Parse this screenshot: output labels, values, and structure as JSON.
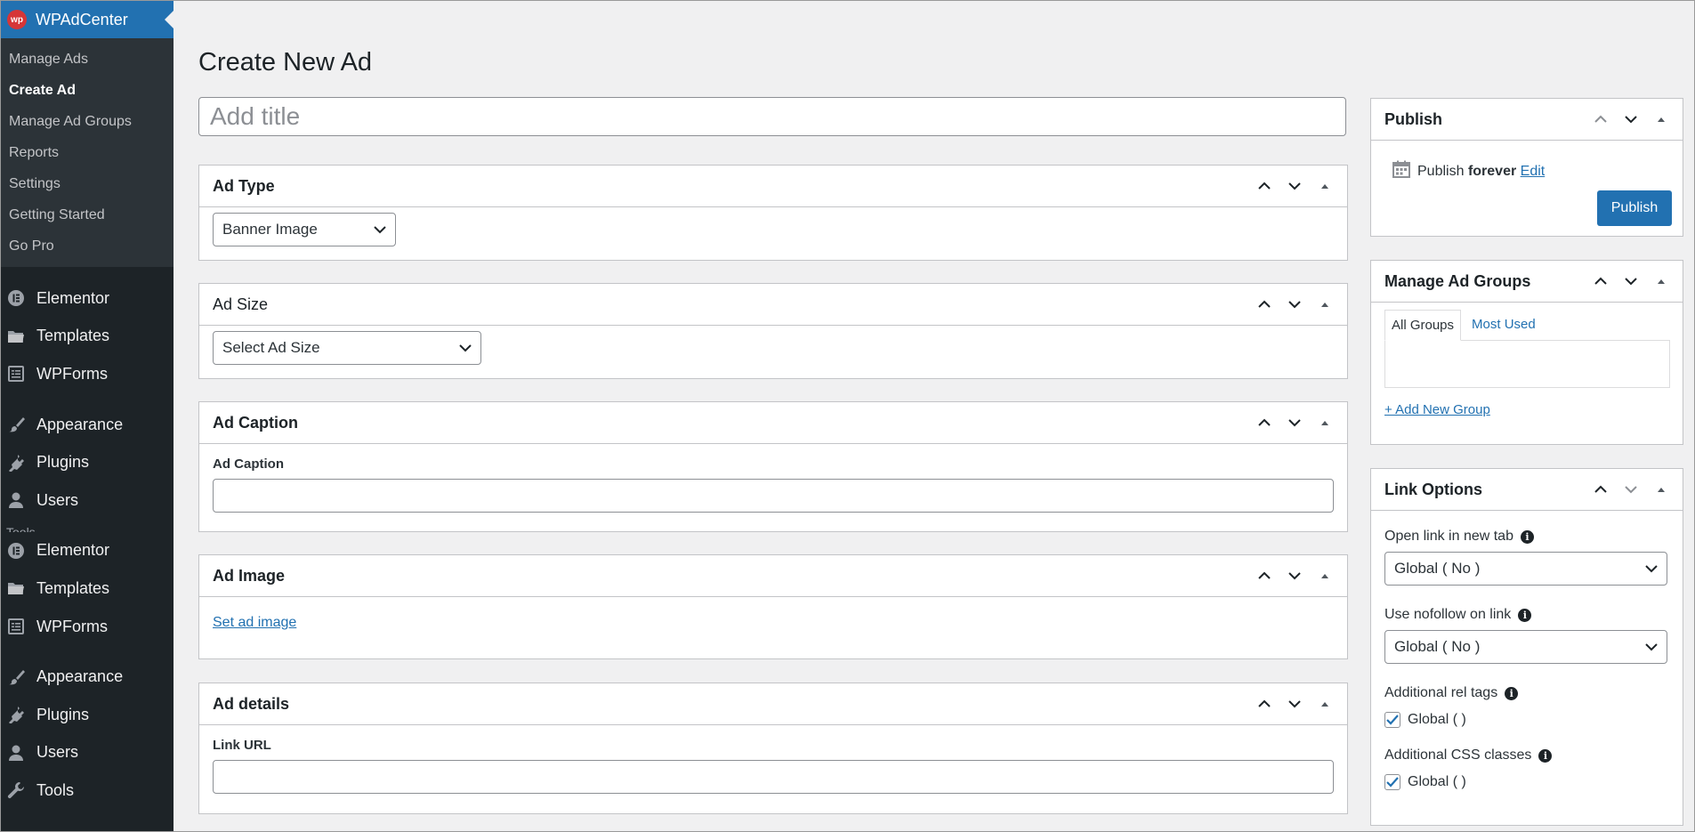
{
  "sidebar": {
    "brand": "WPAdCenter",
    "brand_logo": "wp",
    "submenu": [
      "Manage Ads",
      "Create Ad",
      "Manage Ad Groups",
      "Reports",
      "Settings",
      "Getting Started",
      "Go Pro"
    ],
    "current_submenu": "Create Ad",
    "menu": {
      "elementor": "Elementor",
      "templates": "Templates",
      "wpforms": "WPForms",
      "appearance": "Appearance",
      "plugins": "Plugins",
      "users": "Users",
      "tools_partial": "Tools",
      "tools": "Tools"
    }
  },
  "page": {
    "title": "Create New Ad",
    "title_placeholder": "Add title"
  },
  "ad_type": {
    "heading": "Ad Type",
    "value": "Banner Image"
  },
  "ad_size": {
    "heading": "Ad Size",
    "value": "Select Ad Size"
  },
  "ad_caption": {
    "heading": "Ad Caption",
    "label": "Ad Caption",
    "value": ""
  },
  "ad_image": {
    "heading": "Ad Image",
    "link": "Set ad image"
  },
  "ad_details": {
    "heading": "Ad details",
    "label": "Link URL",
    "value": ""
  },
  "publish": {
    "heading": "Publish",
    "status_prefix": "Publish",
    "status_value": "forever",
    "edit": "Edit",
    "button": "Publish"
  },
  "ad_groups": {
    "heading": "Manage Ad Groups",
    "tab_all": "All Groups",
    "tab_most_used": "Most Used",
    "add_new": "+ Add New Group"
  },
  "link_options": {
    "heading": "Link Options",
    "new_tab_label": "Open link in new tab",
    "new_tab_value": "Global ( No )",
    "nofollow_label": "Use nofollow on link",
    "nofollow_value": "Global ( No )",
    "rel_label": "Additional rel tags",
    "rel_check": "Global ( )",
    "css_label": "Additional CSS classes",
    "css_check": "Global ( )"
  },
  "colors": {
    "accent": "#2271b1",
    "sidebar_bg": "#1d2327",
    "submenu_bg": "#2c3338",
    "brand_logo": "#d63638"
  }
}
